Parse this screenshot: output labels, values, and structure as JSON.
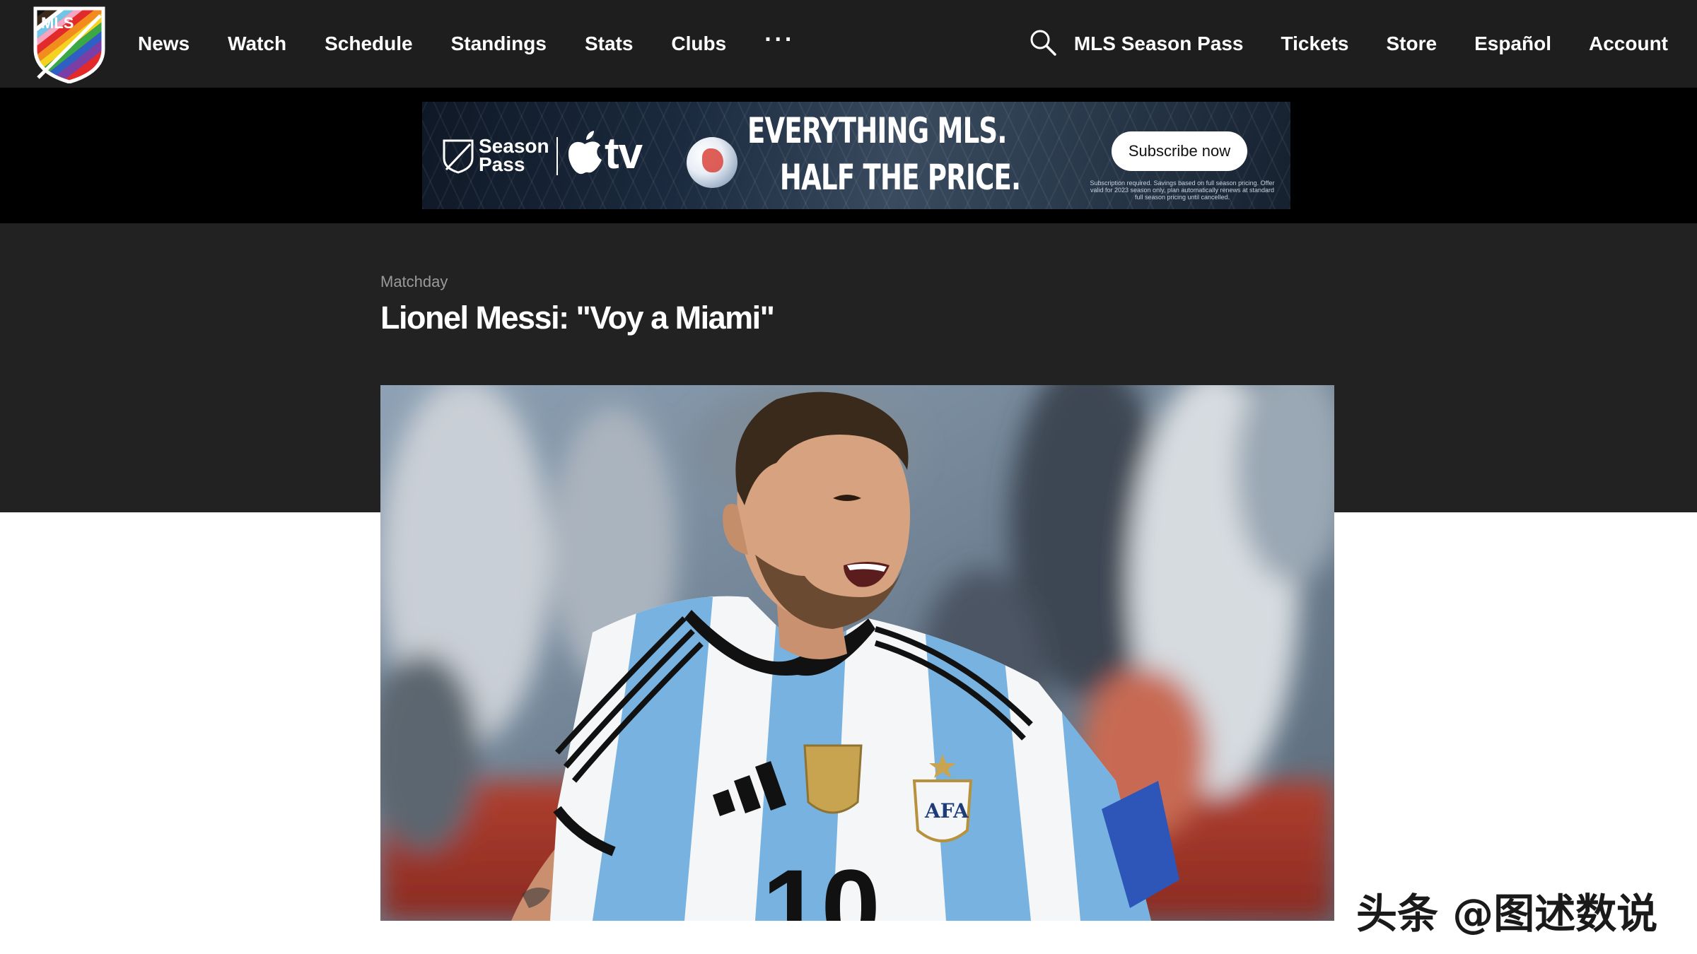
{
  "nav": {
    "logo_text": "MLS",
    "left_links": [
      "News",
      "Watch",
      "Schedule",
      "Standings",
      "Stats",
      "Clubs"
    ],
    "more_label": "···",
    "right_links": [
      "MLS Season Pass",
      "Tickets",
      "Store",
      "Español",
      "Account"
    ],
    "icons": {
      "search": "search-icon",
      "logo": "mls-pride-logo"
    }
  },
  "ad": {
    "brand_line1": "Season",
    "brand_line2": "Pass",
    "tv_label": "tv",
    "headline_line1": "EVERYTHING MLS.",
    "headline_line2": "HALF THE PRICE.",
    "cta": "Subscribe now",
    "fine_print": "Subscription required. Savings based on full season pricing. Offer valid for 2023 season only, plan automatically renews at standard full season pricing until cancelled."
  },
  "article": {
    "category": "Matchday",
    "title": "Lionel Messi: \"Voy a Miami\""
  },
  "hero": {
    "jersey_number": "10",
    "crest_text": "AFA"
  },
  "watermark": "头条 @图述数说",
  "colors": {
    "nav_bg": "#1e1e1e",
    "ad_bg": "#000000",
    "header_bg": "#222222",
    "page_bg": "#ffffff",
    "category_text": "#9a9a9a"
  }
}
